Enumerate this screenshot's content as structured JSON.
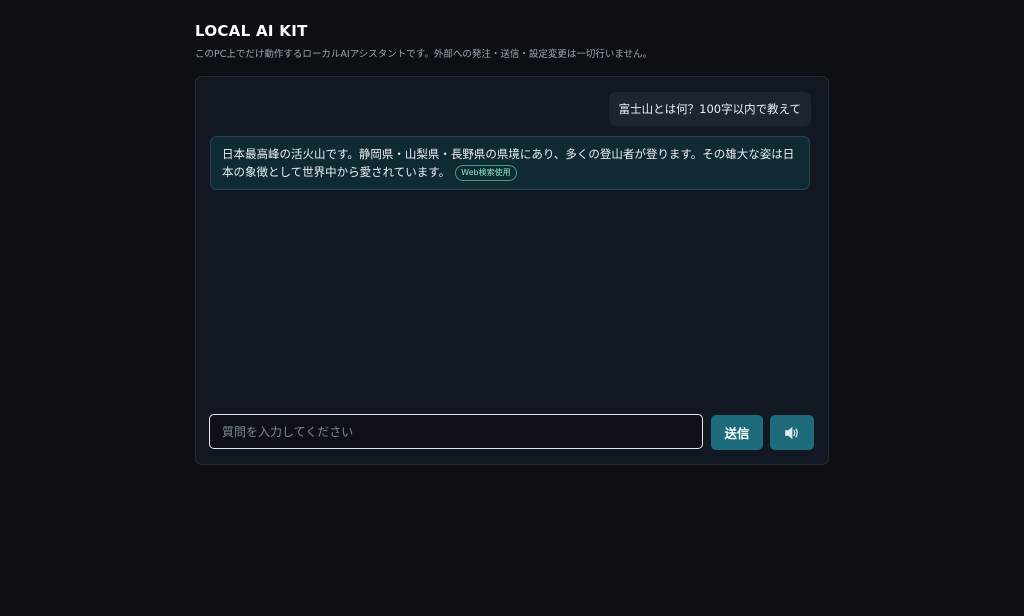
{
  "app": {
    "title": "LOCAL AI KIT",
    "subtitle": "このPC上でだけ動作するローカルAIアシスタントです。外部への発注・送信・設定変更は一切行いません。"
  },
  "chat": {
    "messages": [
      {
        "role": "user",
        "text": "富士山とは何？100字以内で教えて"
      },
      {
        "role": "assistant",
        "text": "日本最高峰の活火山です。静岡県・山梨県・長野県の県境にあり、多くの登山者が登ります。その雄大な姿は日本の象徴として世界中から愛されています。",
        "badge": "Web検索使用"
      }
    ]
  },
  "composer": {
    "placeholder": "質問を入力してください",
    "value": "",
    "send_label": "送信",
    "voice_icon": "speaker-icon"
  },
  "colors": {
    "background": "#0c0f14",
    "panel": "#121821",
    "accent": "#1d6b7c",
    "assistant_bubble": "#0f2a33",
    "badge": "#3aa27a"
  }
}
